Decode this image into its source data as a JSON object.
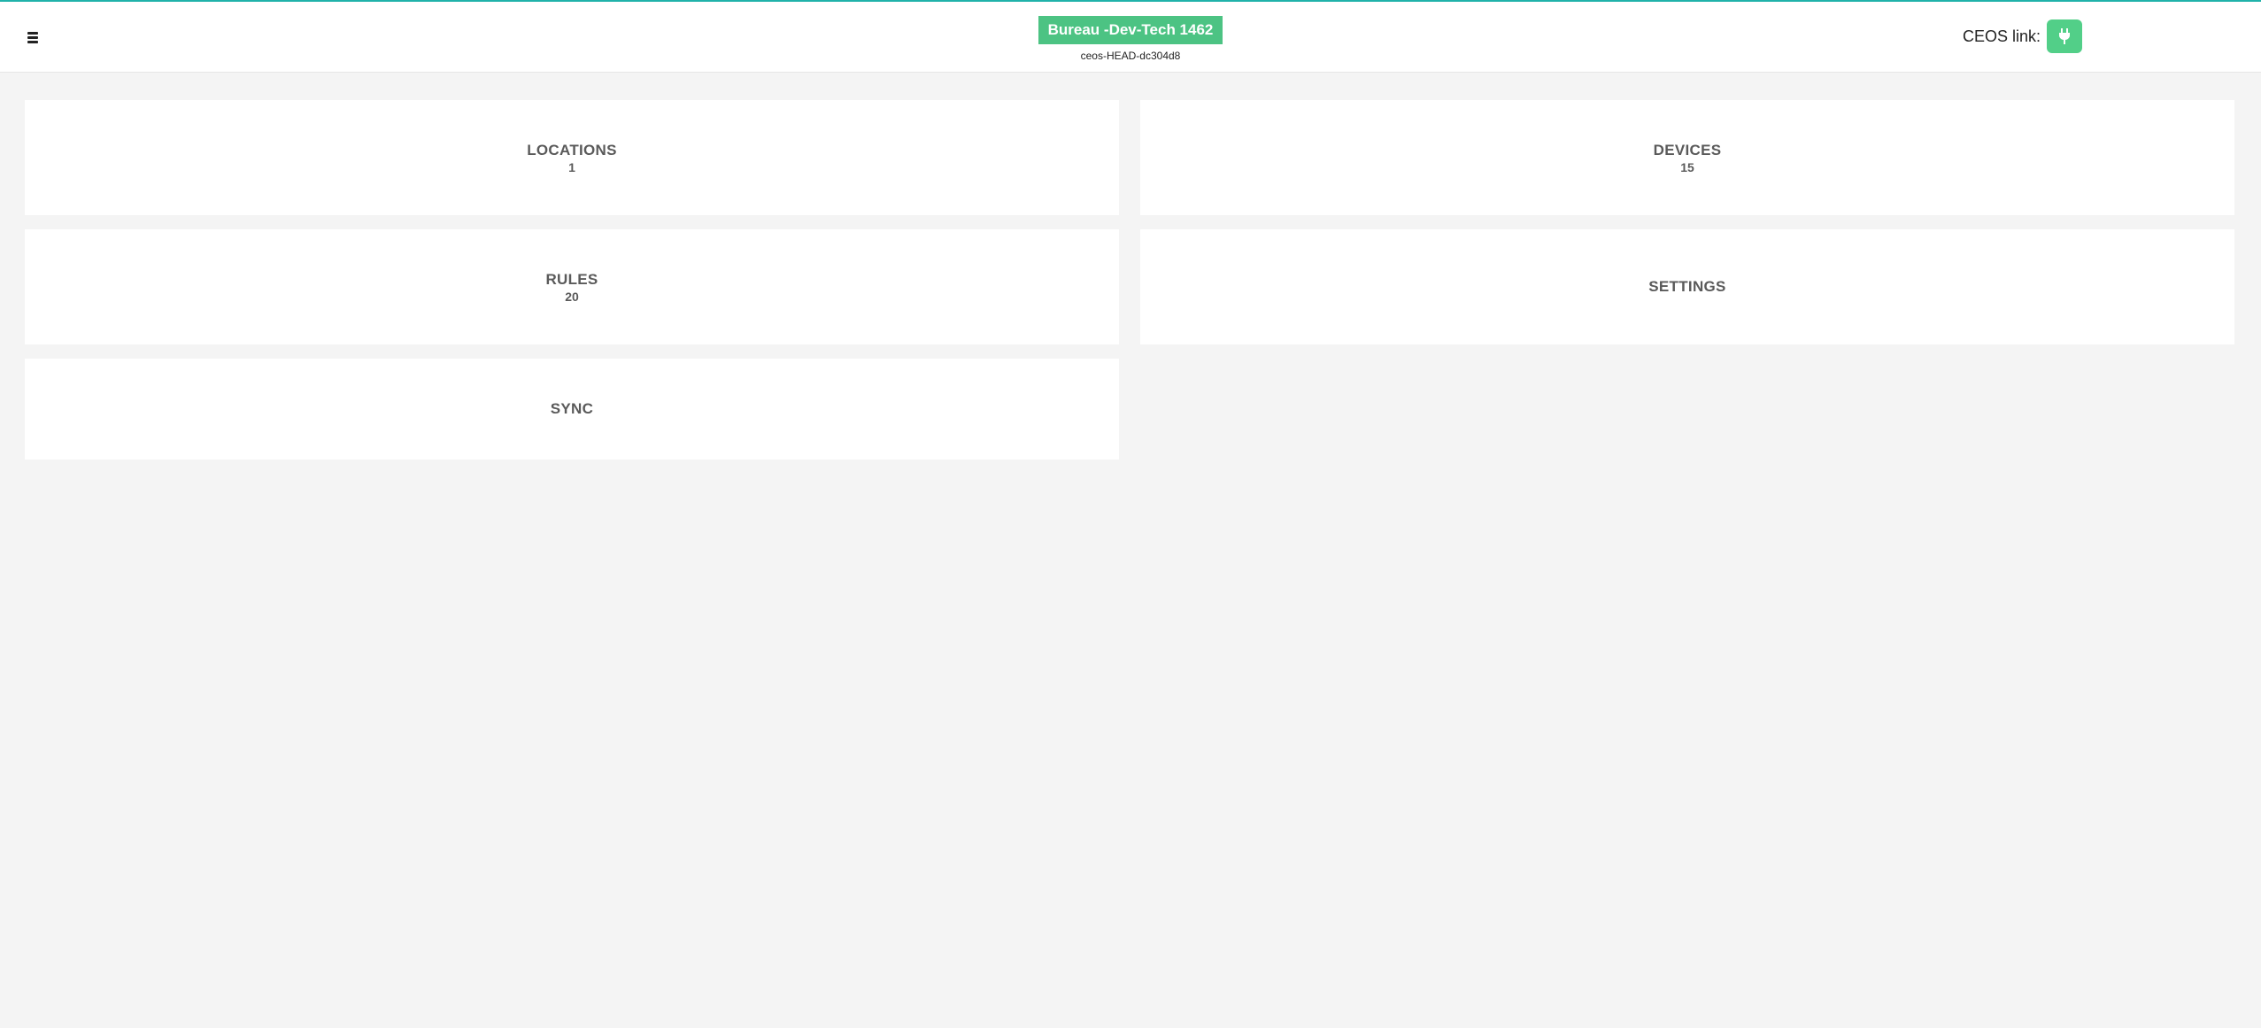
{
  "header": {
    "site_name": "Bureau -Dev-Tech 1462",
    "version": "ceos-HEAD-dc304d8",
    "ceos_link_label": "CEOS link:",
    "menu_icon": "hamburger-menu-icon",
    "ceos_icon": "plug-icon"
  },
  "colors": {
    "accent_line": "#20b2aa",
    "badge": "#4cc383",
    "ceos_button": "#52cf88"
  },
  "cards": {
    "locations": {
      "title": "LOCATIONS",
      "count": "1"
    },
    "devices": {
      "title": "DEVICES",
      "count": "15"
    },
    "rules": {
      "title": "RULES",
      "count": "20"
    },
    "settings": {
      "title": "SETTINGS"
    },
    "sync": {
      "title": "SYNC"
    }
  }
}
